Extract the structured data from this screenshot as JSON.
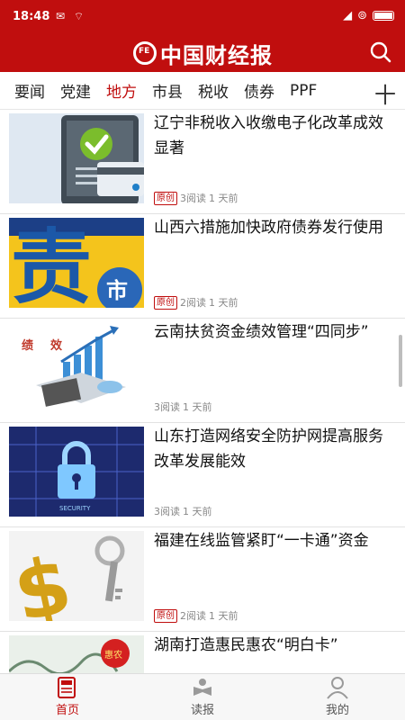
{
  "status_bar": {
    "time": "18:48"
  },
  "header": {
    "logo_mark": "FE",
    "logo_text": "中国财经报"
  },
  "tabs": [
    {
      "label": "要闻",
      "active": false
    },
    {
      "label": "党建",
      "active": false
    },
    {
      "label": "地方",
      "active": true
    },
    {
      "label": "市县",
      "active": false
    },
    {
      "label": "税收",
      "active": false
    },
    {
      "label": "债券",
      "active": false
    },
    {
      "label": "PPF",
      "active": false
    }
  ],
  "add_tab_label": "十",
  "articles": [
    {
      "title": "辽宁非税收入收缴电子化改革成效显著",
      "badge": "原创",
      "reads": "3阅读",
      "time": "1 天前",
      "image": "tablet-checkmark-card"
    },
    {
      "title": "山西六措施加快政府债券发行使用",
      "badge": "原创",
      "reads": "2阅读",
      "time": "1 天前",
      "image": "debt-character-sign",
      "img_text_1": "责",
      "img_text_2": "市"
    },
    {
      "title": "云南扶贫资金绩效管理“四同步”",
      "badge": "",
      "reads": "3阅读",
      "time": "1 天前",
      "image": "performance-chart-calculator",
      "img_text_1": "绩",
      "img_text_2": "效"
    },
    {
      "title": "山东打造网络安全防护网提高服务改革发展能效",
      "badge": "",
      "reads": "3阅读",
      "time": "1 天前",
      "image": "security-padlock",
      "img_text_1": "SECURITY"
    },
    {
      "title": "福建在线监管紧盯“一卡通”资金",
      "badge": "原创",
      "reads": "2阅读",
      "time": "1 天前",
      "image": "dollar-sign-key"
    },
    {
      "title": "湖南打造惠民惠农“明白卡”",
      "badge": "",
      "reads": "",
      "time": "",
      "image": "ink-painting-seal",
      "img_text_1": "惠农"
    }
  ],
  "bottom_nav": [
    {
      "label": "首页",
      "icon": "newspaper-icon",
      "active": true
    },
    {
      "label": "读报",
      "icon": "reader-icon",
      "active": false
    },
    {
      "label": "我的",
      "icon": "person-icon",
      "active": false
    }
  ],
  "colors": {
    "brand": "#c00e0e",
    "text": "#111111",
    "meta": "#888888"
  }
}
